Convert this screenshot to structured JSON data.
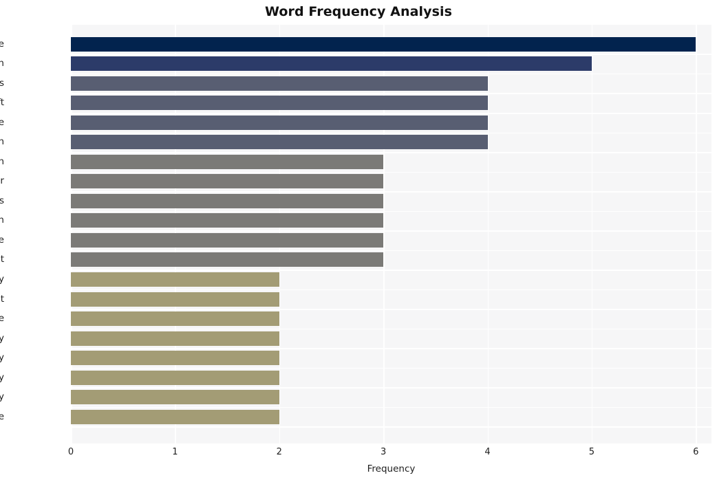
{
  "chart_data": {
    "type": "bar",
    "orientation": "horizontal",
    "title": "Word Frequency Analysis",
    "xlabel": "Frequency",
    "ylabel": "",
    "xlim": [
      0,
      6.15
    ],
    "xticks": [
      "0",
      "1",
      "2",
      "3",
      "4",
      "5",
      "6"
    ],
    "xtick_values": [
      0,
      1,
      2,
      3,
      4,
      5,
      6
    ],
    "grid": true,
    "legend": "none",
    "categories": [
      "exchange",
      "patch",
      "bis",
      "microsoft",
      "vulnerable",
      "warn",
      "german",
      "server",
      "servers",
      "run",
      "software",
      "percent",
      "security",
      "urgent",
      "state",
      "country",
      "germany",
      "vulnerability",
      "company",
      "service"
    ],
    "values": [
      6,
      5,
      4,
      4,
      4,
      4,
      3,
      3,
      3,
      3,
      3,
      3,
      2,
      2,
      2,
      2,
      2,
      2,
      2,
      2
    ],
    "bar_colors": [
      "#02234e",
      "#2c3b69",
      "#585e72",
      "#585e72",
      "#585e72",
      "#585e72",
      "#7b7a77",
      "#7b7a77",
      "#7b7a77",
      "#7b7a77",
      "#7b7a77",
      "#7b7a77",
      "#a39c75",
      "#a39c75",
      "#a39c75",
      "#a39c75",
      "#a39c75",
      "#a39c75",
      "#a39c75",
      "#a39c75"
    ]
  },
  "style": {
    "plot_background": "#f6f6f7",
    "figure_background": "#ffffff",
    "grid_color": "#ffffff",
    "text_color": "#1d1d1d",
    "title_color": "#111111"
  }
}
